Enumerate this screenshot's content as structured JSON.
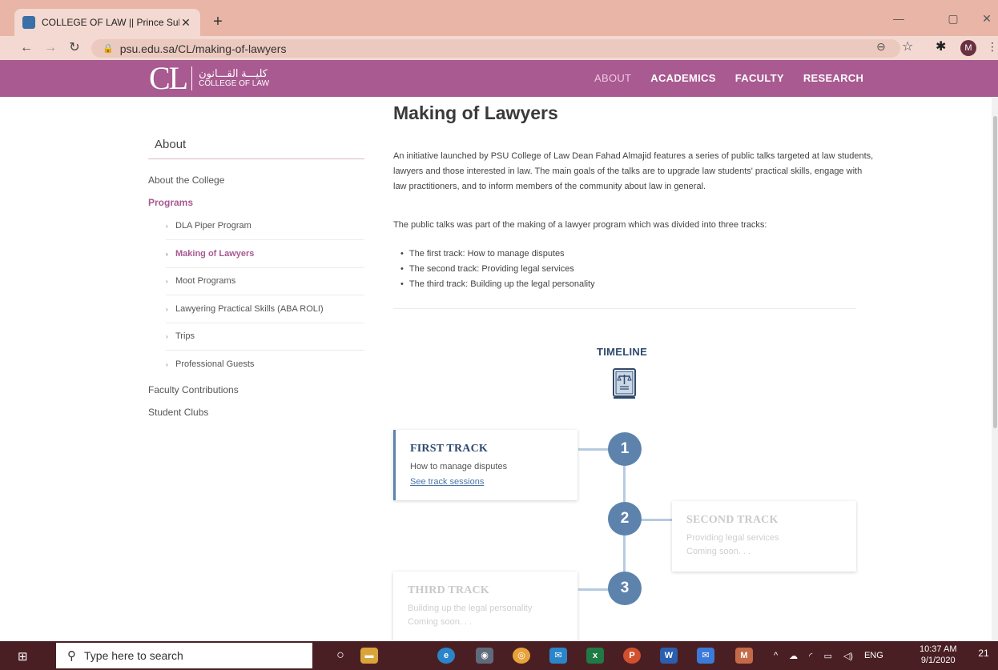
{
  "browser": {
    "tab_title": "COLLEGE OF LAW || Prince Sultan",
    "tab_close": "✕",
    "new_tab": "+",
    "url": "psu.edu.sa/CL/making-of-lawyers",
    "profile_initial": "M"
  },
  "site": {
    "logo_mark": "CL",
    "logo_arabic": "كليـــة القـــانون",
    "logo_english": "COLLEGE OF LAW",
    "nav": [
      "ABOUT",
      "ACADEMICS",
      "FACULTY",
      "RESEARCH"
    ],
    "nav_active": "ABOUT"
  },
  "sidebar": {
    "title": "About",
    "about_college": "About the College",
    "programs": "Programs",
    "sub_items": [
      "DLA Piper Program",
      "Making of Lawyers",
      "Moot Programs",
      "Lawyering Practical Skills (ABA ROLI)",
      "Trips",
      "Professional Guests"
    ],
    "current_sub": "Making of Lawyers",
    "faculty_contributions": "Faculty Contributions",
    "student_clubs": "Student Clubs"
  },
  "content": {
    "title": "Making of Lawyers",
    "intro": "An initiative launched by PSU College of Law Dean Fahad Almajid features a series of public talks targeted at law students, lawyers and those interested in law. The main goals of the talks are to upgrade law students' practical skills, engage with law practitioners, and to inform members of the community about law in general.",
    "tracks_intro": "The public talks was part of the making of a lawyer program which was divided into three tracks:",
    "tracks": [
      "The first track: How to manage disputes",
      "The second track: Providing legal services",
      "The third track: Building up the legal personality"
    ]
  },
  "timeline": {
    "title": "TIMELINE",
    "items": [
      {
        "num": "1",
        "title": "FIRST TRACK",
        "desc": "How to manage disputes",
        "link": "See track sessions"
      },
      {
        "num": "2",
        "title": "SECOND TRACK",
        "desc": "Providing legal services",
        "status": "Coming soon. . ."
      },
      {
        "num": "3",
        "title": "THIRD TRACK",
        "desc": "Building up the legal personality",
        "status": "Coming soon. . ."
      }
    ]
  },
  "taskbar": {
    "search_placeholder": "Type here to search",
    "language": "ENG",
    "time": "10:37 AM",
    "date": "9/1/2020",
    "notifications": "21"
  },
  "colors": {
    "header_purple": "#a85a91",
    "timeline_blue": "#5d83ad",
    "title_navy": "#2f4a6e"
  }
}
